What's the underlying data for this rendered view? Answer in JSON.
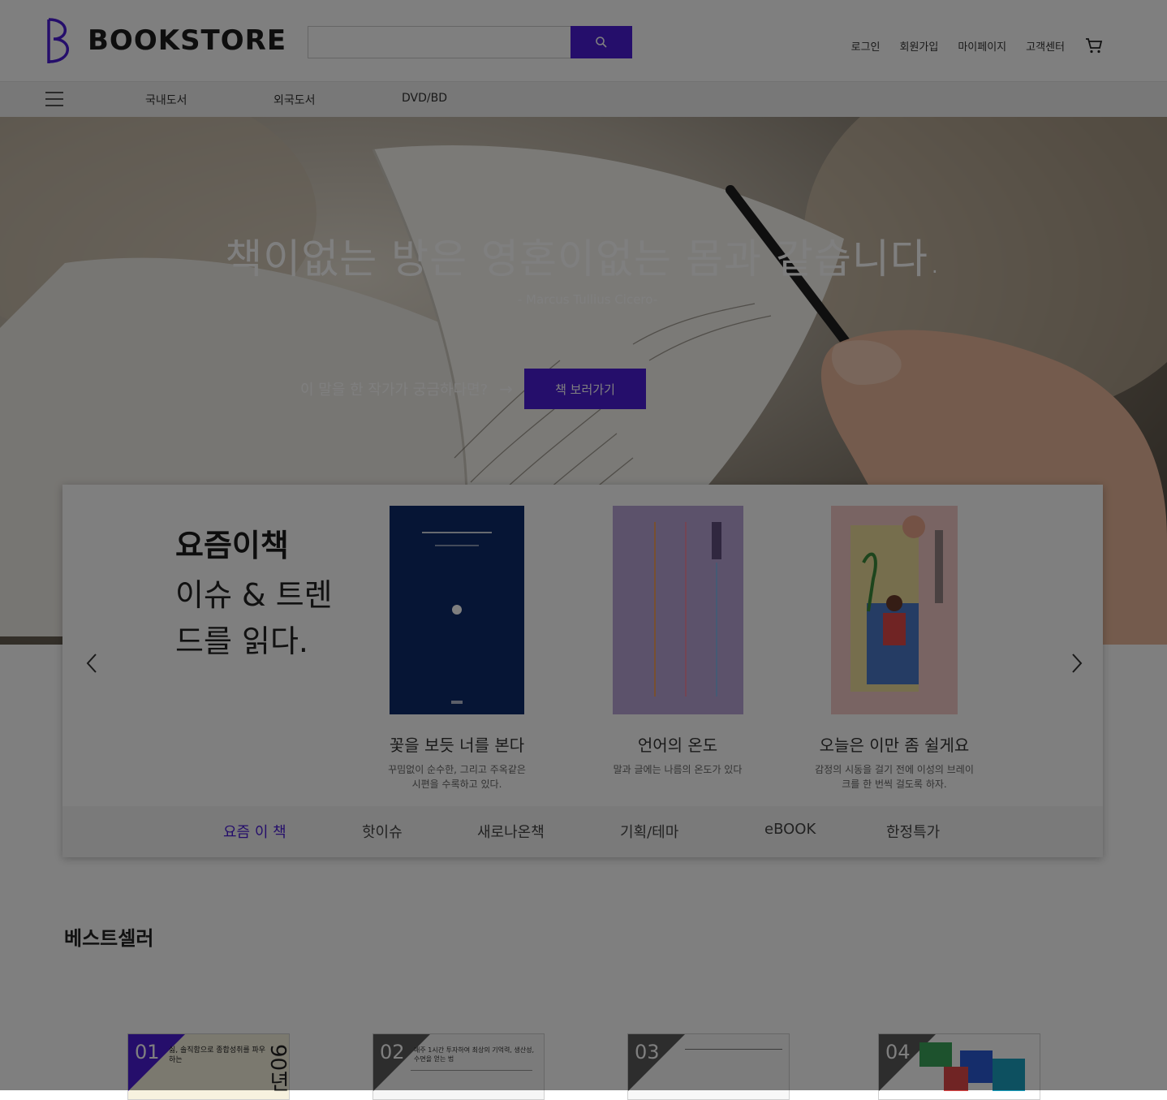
{
  "header": {
    "brand": "BOOKSTORE",
    "search_placeholder": "",
    "links": [
      "로그인",
      "회원가입",
      "마이페이지",
      "고객센터"
    ]
  },
  "nav": {
    "items": [
      "국내도서",
      "외국도서",
      "DVD/BD"
    ]
  },
  "hero": {
    "quote": "책이없는 방은 영혼이없는 몸과 같습니다.",
    "author": "- Marcus Tullius Cicero-",
    "cta_text": "이 말을 한 작가가 궁금하다면?",
    "button": "책 보러가기"
  },
  "featured": {
    "title": "요즘이책",
    "subtitle": "이슈 & 트렌드를 읽다.",
    "books": [
      {
        "title": "꽃을 보듯 너를 본다",
        "desc": "꾸밈없이 순수한, 그리고 주옥같은 시편을 수록하고 있다.",
        "cover_title": "꽃을 보듯 너를 본다",
        "cover_color": "#0c2b6b"
      },
      {
        "title": "언어의 온도",
        "desc": "말과 글에는 나름의 온도가 있다",
        "cover_title": "언어의 온도",
        "cover_color": "#b9a4d6"
      },
      {
        "title": "오늘은 이만 좀 쉴게요",
        "desc": "감정의 시동을 걸기 전에 이성의 브레이크를 한 번씩 걸도록 하자.",
        "cover_title": "오늘은 이만 좀 쉴게요",
        "cover_color": "#f3c9c6"
      }
    ],
    "tabs": [
      "요즘 이 책",
      "핫이슈",
      "새로나온책",
      "기획/테마",
      "eBOOK",
      "한정특가"
    ]
  },
  "bestseller": {
    "title": "베스트셀러",
    "items": [
      {
        "rank": "01",
        "caption": "싫, 솔직함으로 종합성취를 파우하는",
        "side": "90년"
      },
      {
        "rank": "02",
        "caption": "매주 1시간 투자하여 최상의 기억력, 생산성, 수면을 얻는 법",
        "side": ""
      },
      {
        "rank": "03",
        "caption": "",
        "side": ""
      },
      {
        "rank": "04",
        "caption": "",
        "side": ""
      }
    ]
  },
  "colors": {
    "accent": "#4a1dd6",
    "overlay": "rgba(0,0,0,0.5)"
  },
  "icons": [
    "search-icon",
    "cart-icon",
    "hamburger-icon",
    "arrow-right-icon",
    "chevron-left-icon",
    "chevron-right-icon"
  ]
}
